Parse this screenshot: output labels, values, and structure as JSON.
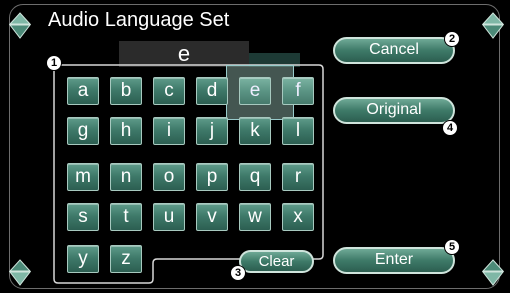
{
  "title": "Audio Language Set",
  "display": {
    "value": "e"
  },
  "buttons": {
    "cancel": "Cancel",
    "original": "Original",
    "enter": "Enter",
    "clear": "Clear"
  },
  "keys": {
    "a": "a",
    "b": "b",
    "c": "c",
    "d": "d",
    "e": "e",
    "f": "f",
    "g": "g",
    "h": "h",
    "i": "i",
    "j": "j",
    "k": "k",
    "l": "l",
    "m": "m",
    "n": "n",
    "o": "o",
    "p": "p",
    "q": "q",
    "r": "r",
    "s": "s",
    "t": "t",
    "u": "u",
    "v": "v",
    "w": "w",
    "x": "x",
    "y": "y",
    "z": "z"
  },
  "callouts": {
    "grid": "1",
    "cancel": "2",
    "clear": "3",
    "original": "4",
    "enter": "5"
  },
  "icons": {
    "scroll_up": "up-arrow-icon",
    "scroll_down": "down-arrow-icon"
  },
  "colors": {
    "key_green": "#3f7a6a",
    "key_border": "#a7c9bf",
    "background": "#000000"
  }
}
